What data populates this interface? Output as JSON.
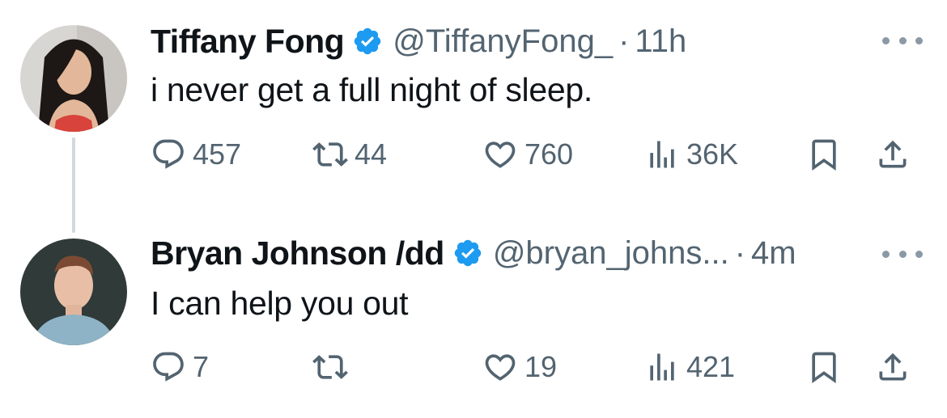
{
  "tweets": [
    {
      "author": {
        "name": "Tiffany Fong",
        "handle": "@TiffanyFong_",
        "verified": true
      },
      "time": "11h",
      "separator": "·",
      "text": "i never get a full night of sleep.",
      "stats": {
        "replies": "457",
        "retweets": "44",
        "likes": "760",
        "views": "36K"
      }
    },
    {
      "author": {
        "name": "Bryan Johnson /dd",
        "handle": "@bryan_johns...",
        "verified": true
      },
      "time": "4m",
      "separator": "·",
      "text": "I can help you out",
      "stats": {
        "replies": "7",
        "retweets": "",
        "likes": "19",
        "views": "421"
      }
    }
  ],
  "icons": {
    "more": "more-horizontal-icon",
    "verified": "verified-badge-icon",
    "reply": "reply-icon",
    "retweet": "retweet-icon",
    "like": "heart-icon",
    "views": "views-icon",
    "bookmark": "bookmark-icon",
    "share": "share-icon"
  },
  "colors": {
    "verified": "#1d9bf0",
    "text": "#0f1419",
    "muted": "#536471",
    "thread_line": "#cfd9de"
  }
}
